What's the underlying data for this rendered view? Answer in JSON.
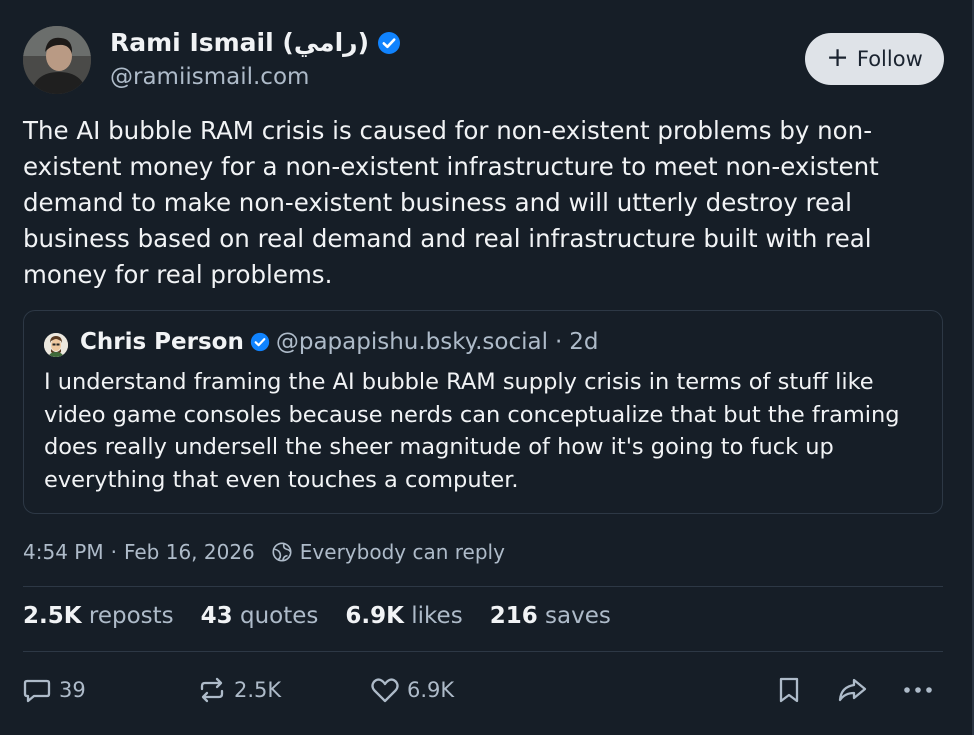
{
  "author": {
    "name": "Rami Ismail (رامي)",
    "handle": "@ramiismail.com"
  },
  "follow_button": {
    "label": "Follow"
  },
  "post": {
    "text": "The AI bubble RAM crisis is caused for non-existent problems by non-existent money for a non-existent infrastructure to meet non-existent demand to make non-existent business and will utterly destroy real business based on real demand and real infrastructure built with real money for real problems."
  },
  "quote": {
    "name": "Chris Person",
    "handle": "@papapishu.bsky.social",
    "separator": "·",
    "time": "2d",
    "text": "I understand framing the AI bubble RAM supply crisis in terms of stuff like video game consoles because nerds can conceptualize that but the framing does really undersell the sheer magnitude of how it's going to fuck up everything that even touches a computer."
  },
  "meta": {
    "timestamp": "4:54 PM",
    "separator": "·",
    "date": "Feb 16, 2026",
    "reply_setting": "Everybody can reply"
  },
  "stats": [
    {
      "count": "2.5K",
      "label": "reposts"
    },
    {
      "count": "43",
      "label": "quotes"
    },
    {
      "count": "6.9K",
      "label": "likes"
    },
    {
      "count": "216",
      "label": "saves"
    }
  ],
  "actions": {
    "replies": "39",
    "reposts": "2.5K",
    "likes": "6.9K"
  },
  "icons": {
    "verified": "verified-badge-icon",
    "reply": "reply-bubble-icon",
    "repost": "repost-icon",
    "like": "heart-icon",
    "bookmark": "bookmark-icon",
    "share": "share-arrow-icon",
    "more": "more-options-icon",
    "globe": "globe-icon"
  },
  "colors": {
    "background": "#161e27",
    "verified": "#1083fe",
    "text": "#f1f3f5",
    "muted": "#aebbc9"
  }
}
